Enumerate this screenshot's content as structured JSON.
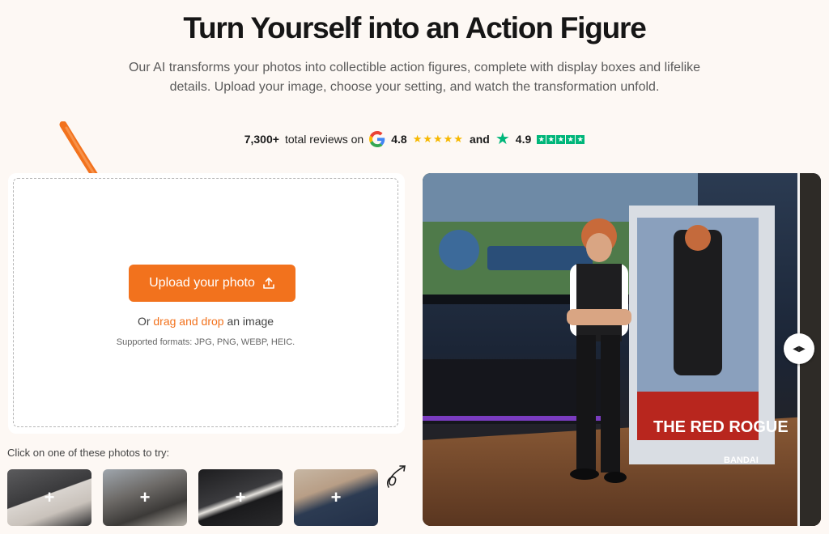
{
  "header": {
    "title": "Turn Yourself into an Action Figure",
    "subtitle": "Our AI transforms your photos into collectible action figures, complete with display boxes and lifelike details. Upload your image, choose your setting, and watch the transformation unfold."
  },
  "reviews": {
    "count": "7,300+",
    "text": "total reviews on",
    "google_rating": "4.8",
    "google_stars": "★★★★★",
    "joiner": "and",
    "trustpilot_rating": "4.9",
    "trustpilot_stars": [
      "★",
      "★",
      "★",
      "★",
      "★"
    ]
  },
  "upload": {
    "button_label": "Upload your photo",
    "drag_prefix": "Or",
    "drag_link": "drag and drop",
    "drag_suffix": "an image",
    "formats": "Supported formats: JPG, PNG, WEBP, HEIC."
  },
  "samples": {
    "label": "Click on one of these photos to try:",
    "plus": "+"
  },
  "preview": {
    "box_title": "THE RED ROGUE",
    "box_brand": "BANDAI"
  },
  "colors": {
    "accent": "#f2721d",
    "google_star": "#f6b800",
    "trustpilot": "#00b67a"
  }
}
